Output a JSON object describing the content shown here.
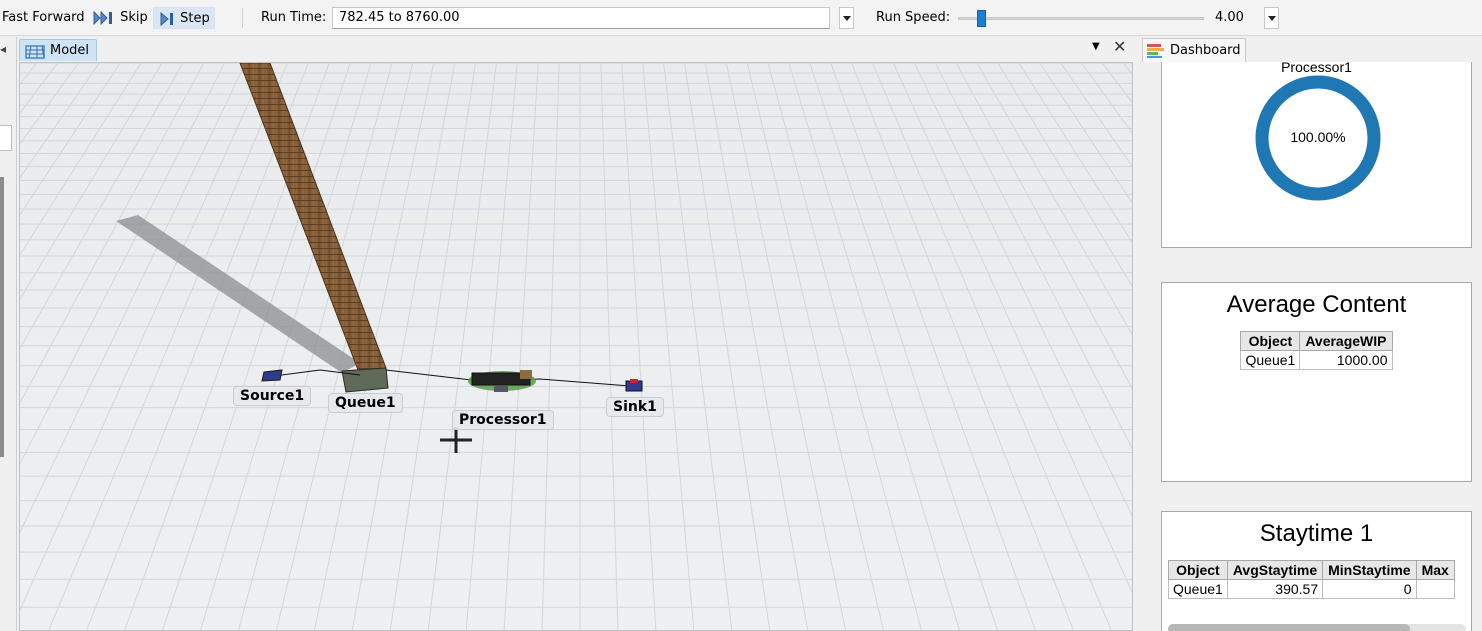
{
  "toolbar": {
    "fast_forward_label": "Fast Forward",
    "skip_label": "Skip",
    "step_label": "Step",
    "run_time_label": "Run Time:",
    "run_time_value": "782.45  to  8760.00",
    "run_speed_label": "Run Speed:",
    "run_speed_value": "4.00",
    "run_speed_fraction": 0.08
  },
  "model": {
    "tab_label": "Model",
    "objects": {
      "source": "Source1",
      "queue": "Queue1",
      "processor": "Processor1",
      "sink": "Sink1"
    }
  },
  "dashboard": {
    "tab_label": "Dashboard",
    "utilization": {
      "title": "Processor1",
      "value_text": "100.00%",
      "value_fraction": 1.0,
      "ring_color": "#1f77b4"
    },
    "average_content": {
      "title": "Average Content",
      "headers": [
        "Object",
        "AverageWIP"
      ],
      "rows": [
        [
          "Queue1",
          "1000.00"
        ]
      ]
    },
    "staytime": {
      "title": "Staytime 1",
      "headers": [
        "Object",
        "AvgStaytime",
        "MinStaytime",
        "Max"
      ],
      "rows": [
        [
          "Queue1",
          "390.57",
          "0",
          ""
        ]
      ]
    }
  }
}
